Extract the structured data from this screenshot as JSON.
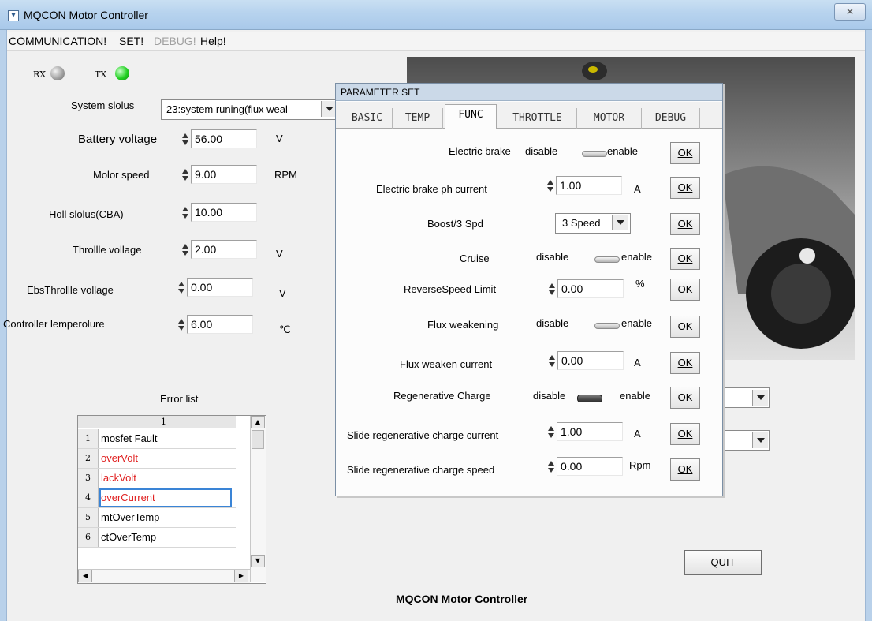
{
  "window": {
    "title": "MQCON Motor Controller",
    "close_glyph": "✕"
  },
  "menu": [
    {
      "label": "COMMUNICATION!",
      "disabled": false
    },
    {
      "label": "SET!",
      "disabled": false
    },
    {
      "label": "DEBUG!",
      "disabled": true
    },
    {
      "label": "Help!",
      "disabled": false
    }
  ],
  "status": {
    "rx_label": "RX",
    "tx_label": "TX",
    "system_status_label": "System slolus",
    "system_status_value": "23:system runing(flux weal"
  },
  "fields": [
    {
      "label": "Battery voltage",
      "value": "56.00",
      "unit": "V"
    },
    {
      "label": "Molor speed",
      "value": "9.00",
      "unit": "RPM"
    },
    {
      "label": "Holl slolus(CBA)",
      "value": "10.00",
      "unit": ""
    },
    {
      "label": "Throllle vollage",
      "value": "2.00",
      "unit": "V"
    },
    {
      "label": "EbsThrollle vollage",
      "value": "0.00",
      "unit": "V"
    },
    {
      "label": "Controller lemperolure",
      "value": "6.00",
      "unit": "℃"
    }
  ],
  "error_list": {
    "title": "Error list",
    "column_header": "1",
    "rows": [
      {
        "n": "1",
        "text": "mosfet Fault",
        "red": false
      },
      {
        "n": "2",
        "text": "overVolt",
        "red": true
      },
      {
        "n": "3",
        "text": "lackVolt",
        "red": true
      },
      {
        "n": "4",
        "text": "overCurrent",
        "red": true
      },
      {
        "n": "5",
        "text": "mtOverTemp",
        "red": false
      },
      {
        "n": "6",
        "text": "ctOverTemp",
        "red": false
      }
    ]
  },
  "dialog": {
    "title": "PARAMETER SET",
    "tabs": [
      "BASIC",
      "TEMP",
      "FUNC",
      "THROTTLE",
      "MOTOR",
      "DEBUG"
    ],
    "active_tab": "FUNC",
    "ok_label": "OK",
    "disable_label": "disable",
    "enable_label": "enable",
    "rows": {
      "electric_brake": {
        "label": "Electric brake"
      },
      "brake_current": {
        "label": "Electric brake ph current",
        "value": "1.00",
        "unit": "A"
      },
      "boost": {
        "label": "Boost/3 Spd",
        "value": "3 Speed"
      },
      "cruise": {
        "label": "Cruise"
      },
      "reverse_speed": {
        "label": "ReverseSpeed Limit",
        "value": "0.00",
        "unit": "%"
      },
      "flux_weakening": {
        "label": "Flux weakening"
      },
      "flux_current": {
        "label": "Flux weaken current",
        "value": "0.00",
        "unit": "A"
      },
      "regen_charge": {
        "label": "Regenerative Charge"
      },
      "slide_current": {
        "label": "Slide regenerative charge current",
        "value": "1.00",
        "unit": "A"
      },
      "slide_speed": {
        "label": "Slide regenerative charge speed",
        "value": "0.00",
        "unit": "Rpm"
      }
    }
  },
  "buttons": {
    "quit": "QUIT"
  },
  "footer": {
    "text": "MQCON Motor Controller"
  }
}
